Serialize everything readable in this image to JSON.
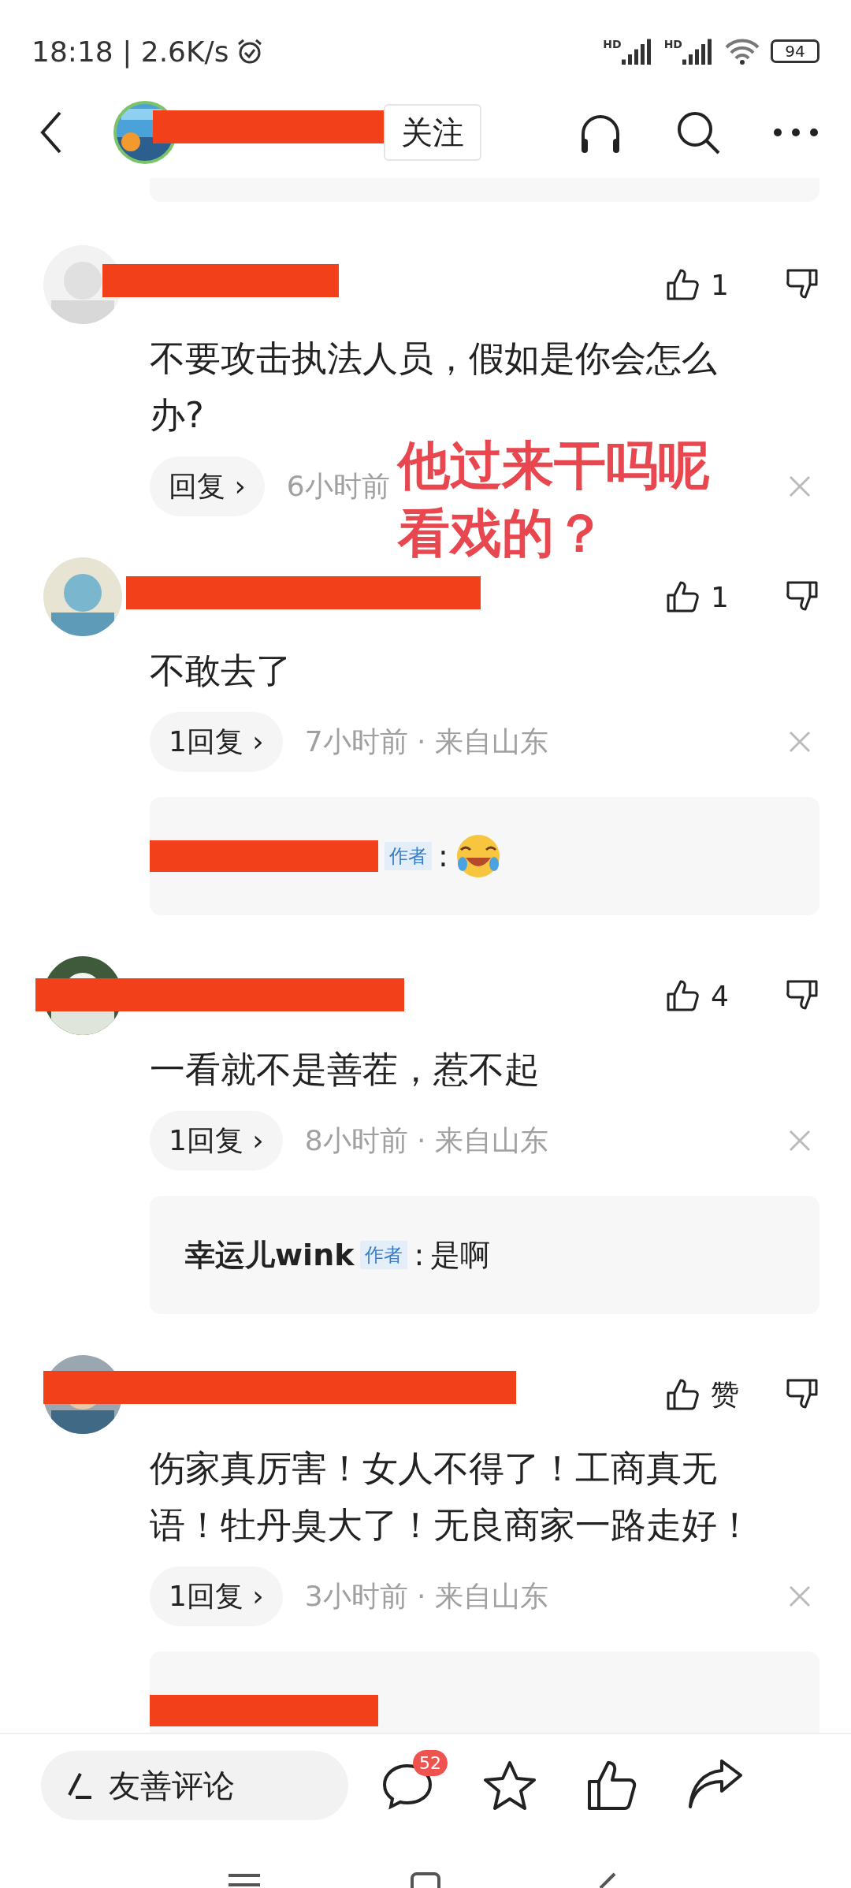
{
  "status_bar": {
    "time": "18:18 | 2.6K/s",
    "signal_labels": [
      "HD",
      "HD"
    ],
    "battery": "94"
  },
  "nav": {
    "follow": "关注"
  },
  "comments": [
    {
      "likes": "1",
      "text": "不要攻击执法人员，假如是你会怎么办?",
      "reply_button": "回复 ›",
      "time": "6小时前"
    },
    {
      "likes": "1",
      "text": "不敢去了",
      "reply_button": "1回复 ›",
      "time": "7小时前 · 来自山东",
      "replies": [
        {
          "kind": "emoji",
          "tag": "作者",
          "separator": ":"
        }
      ]
    },
    {
      "likes": "4",
      "text": "一看就不是善茬，惹不起",
      "reply_button": "1回复 ›",
      "time": "8小时前 · 来自山东",
      "replies": [
        {
          "kind": "text",
          "name": "幸运儿wink",
          "tag": "作者",
          "separator": ":",
          "text": "是啊"
        }
      ]
    },
    {
      "likes": "赞",
      "text": "伤家真厉害！女人不得了！工商真无语！牡丹臭大了！无良商家一路走好！",
      "reply_button": "1回复 ›",
      "time": "3小时前 · 来自山东",
      "replies": [
        {
          "kind": "hidden"
        }
      ]
    }
  ],
  "annotation": [
    "他过来干吗呢",
    "看戏的？"
  ],
  "bottom_bar": {
    "placeholder": "友善评论",
    "comment_count": "52"
  }
}
